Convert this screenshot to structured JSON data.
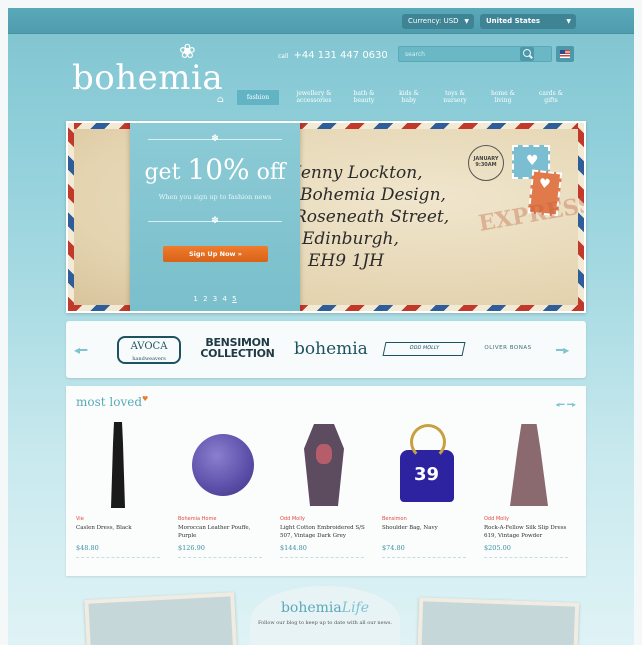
{
  "topbar": {
    "currency": "Currency: USD",
    "country": "United States"
  },
  "header": {
    "logo": "bohemia",
    "phone_prefix": "call",
    "phone": "+44 131 447 0630",
    "search_placeholder": "search"
  },
  "nav": {
    "items": [
      {
        "label": "fashion"
      },
      {
        "label": "jewellery & accessories"
      },
      {
        "label": "bath & beauty"
      },
      {
        "label": "kids & baby"
      },
      {
        "label": "toys & nursery"
      },
      {
        "label": "home & living"
      },
      {
        "label": "cards & gifts"
      }
    ]
  },
  "hero": {
    "offer_prefix": "get",
    "offer_value": "10%",
    "offer_suffix": "off",
    "offer_sub": "When you sign up to fashion news",
    "cta": "Sign Up Now »",
    "pages": [
      "1",
      "2",
      "3",
      "4",
      "5"
    ],
    "script_lines": [
      "Jenny Lockton,",
      "Bohemia Design,",
      "Roseneath Street,",
      "Edinburgh,",
      "EH9 1JH"
    ],
    "postmark": "JANUARY 9:30AM",
    "express": "EXPRESS"
  },
  "brands": {
    "items": [
      {
        "name": "AVOCA",
        "sub": "handweavers"
      },
      {
        "name": "BENSIMON COLLECTION"
      },
      {
        "name": "bohemia"
      },
      {
        "name": "ODD MOLLY"
      },
      {
        "name": "OLIVER BONAS"
      }
    ]
  },
  "most_loved": {
    "title": "most loved",
    "products": [
      {
        "brand": "Vie",
        "name": "Caslen Dress, Black",
        "price": "$48.80"
      },
      {
        "brand": "Bohemia Home",
        "name": "Moroccan Leather Pouffe, Purple",
        "price": "$126.90"
      },
      {
        "brand": "Odd Molly",
        "name": "Light Cotton Embroidered S/S 507, Vintage Dark Grey",
        "price": "$144.80"
      },
      {
        "brand": "Bensimon",
        "name": "Shoulder Bag, Navy",
        "price": "$74.80"
      },
      {
        "brand": "Odd Molly",
        "name": "Rock-A-Fellow Silk Slip Dress 619, Vintage Powder",
        "price": "$205.00"
      }
    ]
  },
  "blog": {
    "logo_main": "bohemia",
    "logo_script": "Life",
    "text": "Follow our blog to keep up to date with all our news."
  },
  "colors": {
    "accent": "#7fc3cf",
    "cta": "#ef7c2b",
    "brand_red": "#e04a3c"
  }
}
